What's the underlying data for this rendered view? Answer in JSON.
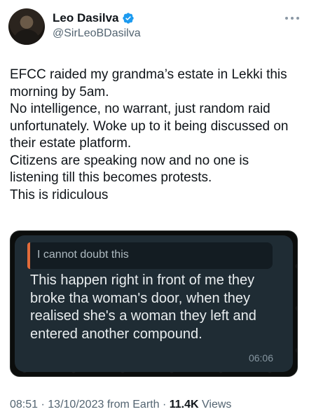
{
  "author": {
    "display_name": "Leo Dasilva",
    "handle": "@SirLeoBDasilva"
  },
  "tweet": {
    "lines": [
      "EFCC raided my grandma’s estate in Lekki this morning by 5am.",
      "No intelligence, no warrant, just random raid unfortunately. Woke up to it being discussed on their estate platform.",
      "Citizens are speaking now and no one is listening till this becomes protests.",
      "This is ridiculous"
    ]
  },
  "media": {
    "quoted_text": "I cannot doubt this",
    "message": "This happen right in front of me they broke tha woman's door, when they realised she's a woman they left and entered another compound.",
    "time": "06:06"
  },
  "meta": {
    "time": "08:51",
    "separator": "·",
    "date": "13/10/2023",
    "source": "from Earth",
    "views_count": "11.4K",
    "views_label": "Views"
  },
  "colors": {
    "verified": "#1d9bf0",
    "secondary_text": "#536471",
    "quote_accent": "#e26b3a"
  },
  "icons": {
    "verified": "verified-badge-icon",
    "more": "more-options-icon"
  }
}
